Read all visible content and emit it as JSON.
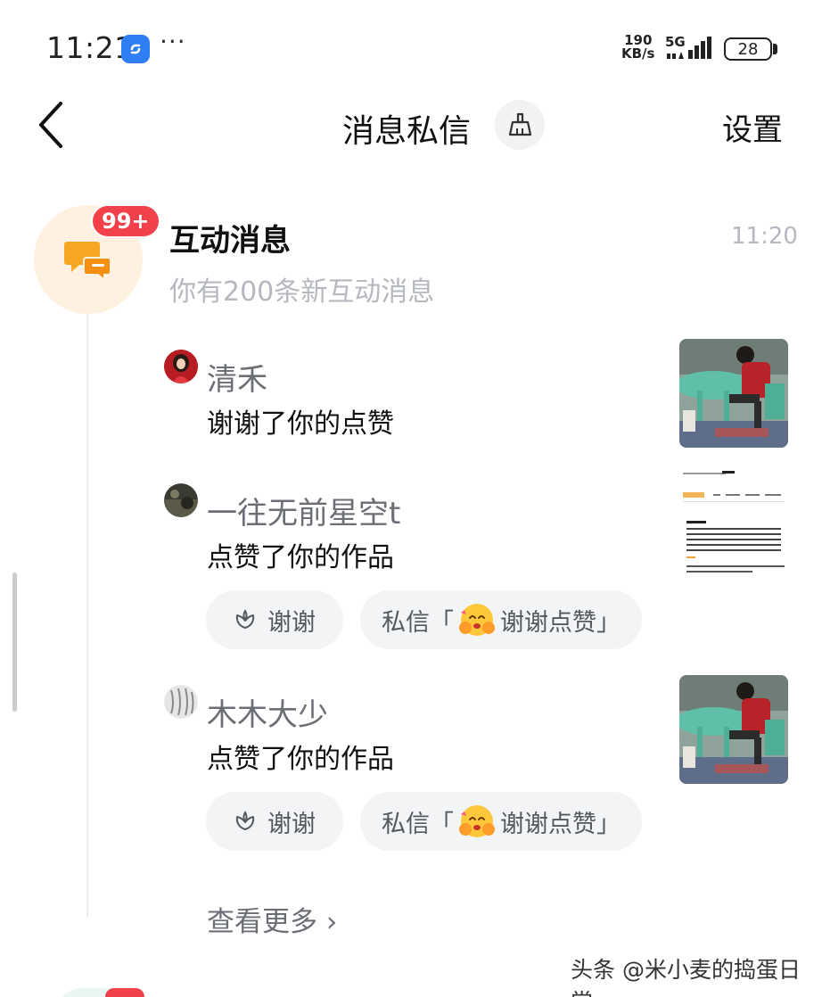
{
  "status_bar": {
    "time": "11:21",
    "more": "···",
    "net_speed_value": "190",
    "net_speed_unit": "KB/s",
    "network": "5G",
    "battery": "28"
  },
  "header": {
    "title": "消息私信",
    "settings": "设置",
    "back_icon": "chevron-left-icon",
    "clean_icon": "broom-icon"
  },
  "group": {
    "title": "互动消息",
    "badge": "99+",
    "time": "11:20",
    "subtitle": "你有200条新互动消息",
    "icon": "chat-bubbles-icon",
    "accent": "#f6a623"
  },
  "items": [
    {
      "name": "清禾",
      "action": "谢谢了你的点赞"
    },
    {
      "name": "一往无前星空t",
      "action": "点赞了你的作品",
      "thanks_label": "谢谢",
      "dm_prefix": "私信「",
      "dm_text": "谢谢点赞」"
    },
    {
      "name": "木木大少",
      "action": "点赞了你的作品",
      "thanks_label": "谢谢",
      "dm_prefix": "私信「",
      "dm_text": "谢谢点赞」"
    }
  ],
  "more_label": "查看更多 ›",
  "watermark": "头条 @米小麦的捣蛋日常",
  "colors": {
    "badge": "#f3414b",
    "muted_text": "#b5b8be",
    "pill_bg": "#f3f4f6"
  }
}
